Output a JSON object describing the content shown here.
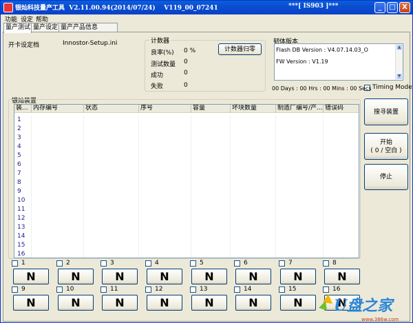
{
  "titlebar": {
    "title": "银灿科技量产工具  V2.11.00.94(2014/07/24)    V119_00_07241",
    "status": "***[ IS903 ]***",
    "minimize": "_",
    "maximize": "□",
    "close": "X"
  },
  "menu": [
    "功能",
    "设定",
    "帮助"
  ],
  "tabs": [
    "量产测试",
    "量产设定",
    "量产产品信息"
  ],
  "settings": {
    "label": "开卡设定档",
    "value": "Innostor-Setup.ini"
  },
  "counter": {
    "title": "计数器",
    "rows": [
      {
        "label": "良率(%)",
        "value": "0 %"
      },
      {
        "label": "测试数量",
        "value": "0"
      },
      {
        "label": "成功",
        "value": "0"
      },
      {
        "label": "失败",
        "value": "0"
      }
    ],
    "reset_label": "计数器归零"
  },
  "firmware": {
    "title": "韧体版本",
    "flash_db": "Flash DB Version :  V4.07.14.03_O",
    "fw": "FW Version :    V1.19"
  },
  "timer": "00 Days : 00 Hrs : 00 Mins : 00 Secs",
  "timing_mode": "Timing Mode",
  "devices": {
    "title": "银灿装置",
    "columns": [
      "装...",
      "内存编号",
      "状态",
      "序号",
      "容量",
      "坏块数量",
      "制造厂编号/产...",
      "错误码"
    ],
    "rows": [
      "1",
      "2",
      "3",
      "4",
      "5",
      "6",
      "7",
      "8",
      "9",
      "10",
      "11",
      "12",
      "13",
      "14",
      "15",
      "16"
    ]
  },
  "actions": {
    "search": "搜寻装置",
    "start_line1": "开始",
    "start_line2": "( 0 / 空白 )",
    "stop": "停止"
  },
  "slots": [
    {
      "num": "1",
      "state": "N"
    },
    {
      "num": "2",
      "state": "N"
    },
    {
      "num": "3",
      "state": "N"
    },
    {
      "num": "4",
      "state": "N"
    },
    {
      "num": "5",
      "state": "N"
    },
    {
      "num": "6",
      "state": "N"
    },
    {
      "num": "7",
      "state": "N"
    },
    {
      "num": "8",
      "state": "N"
    },
    {
      "num": "9",
      "state": "N"
    },
    {
      "num": "10",
      "state": "N"
    },
    {
      "num": "11",
      "state": "N"
    },
    {
      "num": "12",
      "state": "N"
    },
    {
      "num": "13",
      "state": "N"
    },
    {
      "num": "14",
      "state": "N"
    },
    {
      "num": "15",
      "state": "N"
    },
    {
      "num": "16",
      "state": "N"
    }
  ],
  "watermark": {
    "text": "U盘之家",
    "url": "www.386w.com"
  }
}
